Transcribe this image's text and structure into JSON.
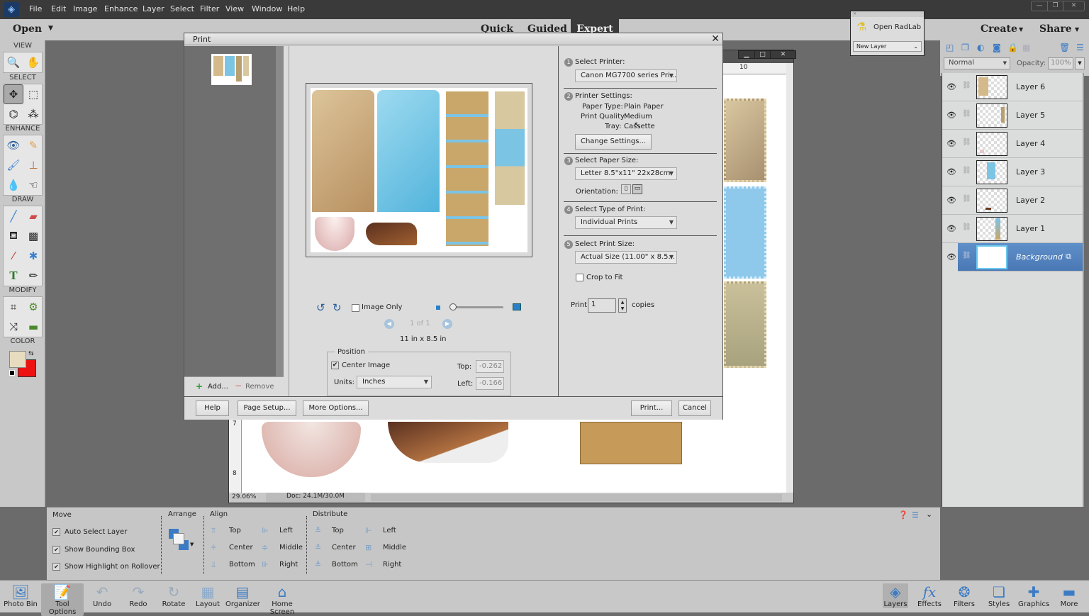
{
  "menubar": {
    "items": [
      "File",
      "Edit",
      "Image",
      "Enhance",
      "Layer",
      "Select",
      "Filter",
      "View",
      "Window",
      "Help"
    ]
  },
  "header": {
    "open": "Open",
    "modes": [
      "Quick",
      "Guided",
      "Expert"
    ],
    "active_mode": "Expert",
    "create": "Create",
    "share": "Share"
  },
  "toolbox": {
    "sections": [
      "VIEW",
      "SELECT",
      "ENHANCE",
      "DRAW",
      "MODIFY",
      "COLOR"
    ],
    "colors": {
      "foreground": "#e8dcc0",
      "background": "#ee1111"
    }
  },
  "radlab": {
    "title": "Open RadLab",
    "dropdown": "New Layer"
  },
  "layers_panel": {
    "blend_mode": "Normal",
    "opacity_label": "Opacity:",
    "opacity": "100%",
    "layers": [
      "Layer 6",
      "Layer 5",
      "Layer 4",
      "Layer 3",
      "Layer 2",
      "Layer 1",
      "Background"
    ],
    "selected": "Background"
  },
  "print_dialog": {
    "title": "Print",
    "add": "Add...",
    "remove": "Remove",
    "image_only": "Image Only",
    "page_indicator": "1 of 1",
    "print_dimensions": "11 in x 8.5 in",
    "position": {
      "legend": "Position",
      "center_image": "Center Image",
      "center_checked": true,
      "units_label": "Units:",
      "units": "Inches",
      "top_label": "Top:",
      "top": "-0.262",
      "left_label": "Left:",
      "left": "-0.166"
    },
    "steps": {
      "s1": {
        "num": "1",
        "label": "Select Printer:",
        "value": "Canon MG7700 series Pri..."
      },
      "s2": {
        "num": "2",
        "label": "Printer Settings:",
        "paper_type_label": "Paper Type:",
        "paper_type": "Plain Paper",
        "quality_label": "Print Quality:",
        "quality": "Medium",
        "tray_label": "Tray:",
        "tray": "Cassette",
        "change": "Change Settings..."
      },
      "s3": {
        "num": "3",
        "label": "Select Paper Size:",
        "value": "Letter 8.5\"x11\" 22x28cm",
        "orientation_label": "Orientation:"
      },
      "s4": {
        "num": "4",
        "label": "Select Type of Print:",
        "value": "Individual Prints"
      },
      "s5": {
        "num": "5",
        "label": "Select Print Size:",
        "value": "Actual Size (11.00\" x 8.5...",
        "crop_to_fit": "Crop to Fit"
      }
    },
    "copies": {
      "label": "Print",
      "value": "1",
      "suffix": "copies"
    },
    "buttons": {
      "help": "Help",
      "page_setup": "Page Setup...",
      "more_options": "More Options...",
      "print": "Print...",
      "cancel": "Cancel"
    }
  },
  "document": {
    "zoom": "29.06%",
    "doc_size": "Doc: 24.1M/30.0M",
    "ruler_top": "10",
    "ruler_left": [
      "7",
      "8"
    ]
  },
  "tool_options": {
    "move": {
      "title": "Move",
      "options": [
        "Auto Select Layer",
        "Show Bounding Box",
        "Show Highlight on Rollover"
      ]
    },
    "arrange": "Arrange",
    "align": {
      "title": "Align",
      "items": [
        "Top",
        "Center",
        "Bottom",
        "Left",
        "Middle",
        "Right"
      ]
    },
    "distribute": {
      "title": "Distribute",
      "items": [
        "Top",
        "Center",
        "Bottom",
        "Left",
        "Middle",
        "Right"
      ]
    }
  },
  "bottombar": {
    "left": [
      "Photo Bin",
      "Tool Options",
      "Undo",
      "Redo",
      "Rotate",
      "Layout",
      "Organizer",
      "Home Screen"
    ],
    "right": [
      "Layers",
      "Effects",
      "Filters",
      "Styles",
      "Graphics",
      "More"
    ]
  }
}
